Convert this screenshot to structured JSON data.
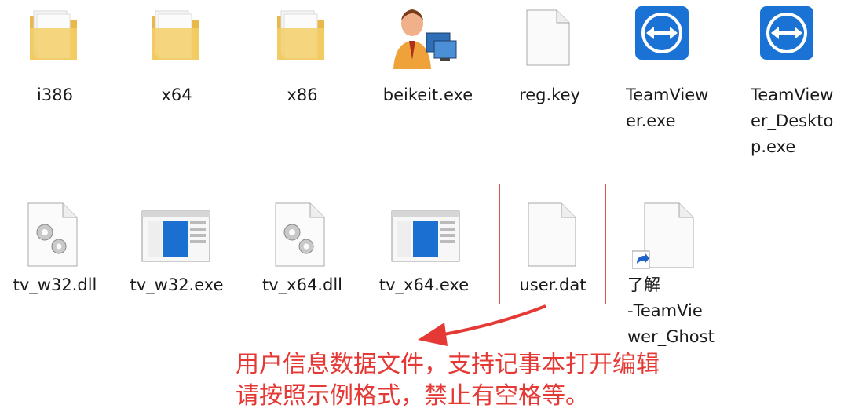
{
  "files": [
    {
      "name": "i386",
      "type": "folder"
    },
    {
      "name": "x64",
      "type": "folder"
    },
    {
      "name": "x86",
      "type": "folder"
    },
    {
      "name": "beikeit.exe",
      "type": "exe-person"
    },
    {
      "name": "reg.key",
      "type": "blank-file"
    },
    {
      "name": "TeamViewer.exe",
      "label_display": "TeamView\ner.exe",
      "type": "teamviewer"
    },
    {
      "name": "TeamViewer_Desktop.exe",
      "label_display": "TeamView\ner_Deskto\np.exe",
      "type": "teamviewer"
    },
    {
      "name": "tv_w32.dll",
      "type": "dll"
    },
    {
      "name": "tv_w32.exe",
      "type": "window-exe"
    },
    {
      "name": "tv_x64.dll",
      "type": "dll"
    },
    {
      "name": "tv_x64.exe",
      "type": "window-exe"
    },
    {
      "name": "user.dat",
      "type": "blank-file",
      "highlighted": true
    },
    {
      "name": "了解-TeamViewer_Ghost",
      "label_display": "了解\n-TeamVie\nwer_Ghost",
      "type": "shortcut"
    }
  ],
  "annotation": {
    "text": "用户信息数据文件，支持记事本打开编辑\n请按照示例格式，禁止有空格等。",
    "color": "#e53935"
  }
}
